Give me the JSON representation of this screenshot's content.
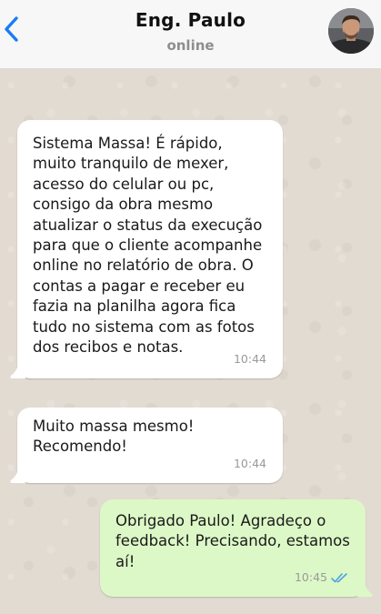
{
  "header": {
    "contact_name": "Eng. Paulo",
    "status": "online",
    "back_icon": "chevron-left-icon",
    "accent_color": "#1a7cf4"
  },
  "messages": [
    {
      "direction": "incoming",
      "text": "Sistema Massa! É rápido, muito tranquilo de mexer, acesso do celular ou pc, consigo da obra mesmo atualizar o status da execução para que o cliente acompanhe online no relatório de obra. O contas a pagar e receber eu fazia na planilha agora fica tudo no sistema com as fotos dos recibos e notas.",
      "time": "10:44"
    },
    {
      "direction": "incoming",
      "text": "Muito massa mesmo! Recomendo!",
      "time": "10:44"
    },
    {
      "direction": "outgoing",
      "text": "Obrigado Paulo! Agradeço o feedback! Precisando, estamos aí!",
      "time": "10:45",
      "receipt_icon": "double-check-read-icon"
    }
  ],
  "colors": {
    "incoming_bubble": "#ffffff",
    "outgoing_bubble": "#dcf8c6",
    "read_receipt": "#4fa3e0"
  }
}
